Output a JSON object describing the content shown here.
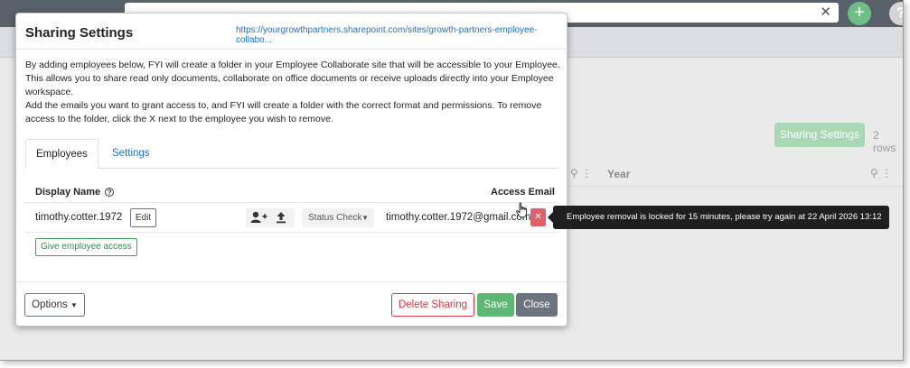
{
  "modal": {
    "title": "Sharing Settings",
    "url": "https://yourgrowthpartners.sharepoint.com/sites/growth-partners-employee-collabo...",
    "description": [
      "By adding employees below, FYI will create a folder in your Employee Collaborate site that will be accessible to your Employee.",
      "This allows you to share read only documents, collaborate on office documents or receive uploads directly into your Employee workspace.",
      "Add the emails you want to grant access to, and FYI will create a folder with the correct format and permissions. To remove access to the folder, click the X next to the employee you wish to remove."
    ],
    "tabs": [
      {
        "label": "Employees",
        "active": true
      },
      {
        "label": "Settings",
        "active": false
      }
    ],
    "columns": {
      "display_name": "Display Name",
      "access_email": "Access Email"
    },
    "employee": {
      "display_name": "timothy.cotter.1972",
      "edit_label": "Edit",
      "status_label": "Status Check",
      "access_email": "timothy.cotter.1972@gmail.com"
    },
    "give_access_label": "Give employee access",
    "footer": {
      "options_label": "Options",
      "delete_label": "Delete Sharing",
      "save_label": "Save",
      "close_label": "Close"
    }
  },
  "tooltip": {
    "text": "Employee removal is locked for 15 minutes, please try again at 22 April 2026 13:12"
  },
  "background": {
    "sharing_settings_label": "Sharing Settings",
    "rows_text": "2 rows",
    "column_year": "Year"
  },
  "colors": {
    "accent_blue": "#1a73c8",
    "success_green": "#5cb874",
    "danger_red": "#dc3545",
    "remove_red": "#e1616b",
    "secondary_gray": "#6c757d"
  }
}
